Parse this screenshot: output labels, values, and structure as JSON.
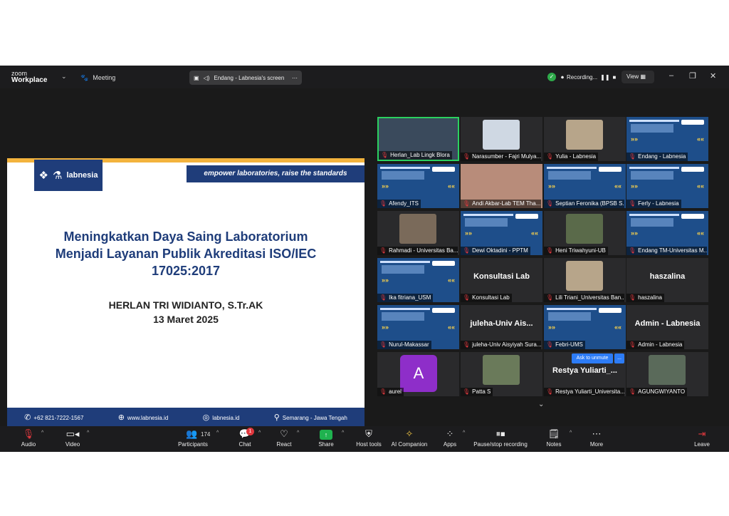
{
  "topbar": {
    "brand_small": "zoom",
    "brand_big": "Workplace",
    "meeting_label": "Meeting",
    "share_label": "Endang - Labnesia's screen",
    "recording_label": "Recording...",
    "view_label": "View"
  },
  "slide": {
    "logo_org": "labnesia",
    "tagline": "empower laboratories, raise the standards",
    "title_line1": "Meningkatkan Daya Saing Laboratorium",
    "title_line2": "Menjadi Layanan Publik Akreditasi ISO/IEC",
    "title_line3": "17025:2017",
    "presenter": "HERLAN TRI WIDIANTO, S.Tr.AK",
    "date": "13 Maret 2025",
    "footer": {
      "phone": "+62 821-7222-1567",
      "web": "www.labnesia.id",
      "instagram": "labnesia.id",
      "location": "Semarang - Jawa Tengah"
    }
  },
  "participants": [
    {
      "name": "Herlan_Lab Lingk Blora",
      "bigname": ""
    },
    {
      "name": "Narasumber - Fajri Mulya...",
      "bigname": ""
    },
    {
      "name": "Yulia - Labnesia",
      "bigname": ""
    },
    {
      "name": "Endang - Labnesia",
      "bigname": ""
    },
    {
      "name": "Afendy_ITS",
      "bigname": ""
    },
    {
      "name": "Andi Akbar-Lab TEM Tha...",
      "bigname": ""
    },
    {
      "name": "Septian Feronika (BPSB S...",
      "bigname": ""
    },
    {
      "name": "Ferly - Labnesia",
      "bigname": ""
    },
    {
      "name": "Rahmadi - Universitas Ba...",
      "bigname": ""
    },
    {
      "name": "Dewi Oktadini - PPTM",
      "bigname": ""
    },
    {
      "name": "Heni Triwahyuni-UB",
      "bigname": ""
    },
    {
      "name": "Endang TM-Universitas M...",
      "bigname": ""
    },
    {
      "name": "Ika fitriana_USM",
      "bigname": ""
    },
    {
      "name": "Konsultasi Lab",
      "bigname": "Konsultasi Lab"
    },
    {
      "name": "Lili Triani_Universitas Ban...",
      "bigname": ""
    },
    {
      "name": "haszalina",
      "bigname": "haszalina"
    },
    {
      "name": "Nurul-Makassar",
      "bigname": ""
    },
    {
      "name": "juleha-Univ Aisyiyah Sura...",
      "bigname": "juleha-Univ  Ais..."
    },
    {
      "name": "Febri-UMS",
      "bigname": ""
    },
    {
      "name": "Admin - Labnesia",
      "bigname": "Admin - Labnesia"
    },
    {
      "name": "aurel",
      "bigname": "",
      "initial": "A"
    },
    {
      "name": "Patta S",
      "bigname": ""
    },
    {
      "name": "Restya Yuliarti_Universita...",
      "bigname": "Restya  Yuliarti_..."
    },
    {
      "name": "AGUNGWIYANTO",
      "bigname": ""
    }
  ],
  "unmute": {
    "label": "Ask to unmute",
    "more": "..."
  },
  "toolbar": {
    "audio": "Audio",
    "video": "Video",
    "participants": "Participants",
    "participant_count": "174",
    "chat": "Chat",
    "chat_badge": "1",
    "react": "React",
    "share": "Share",
    "host_tools": "Host tools",
    "ai_companion": "AI Companion",
    "apps": "Apps",
    "pause_recording": "Pause/stop recording",
    "notes": "Notes",
    "more": "More",
    "leave": "Leave"
  },
  "colors": {
    "brand_blue": "#1f3d7a",
    "accent_orange": "#f3b33d",
    "active_speaker": "#2bd160",
    "muted_red": "#e0383e",
    "share_green": "#1fb24f"
  },
  "icons": [
    "dropdown-chevron-icon",
    "paw-icon",
    "screen-share-icon",
    "shield-icon",
    "record-icon",
    "mic-muted-icon",
    "camera-icon",
    "people-icon",
    "chat-icon",
    "heart-icon",
    "share-up-icon",
    "shield-host-icon",
    "sparkle-icon",
    "apps-icon",
    "pause-icon",
    "notes-icon",
    "more-icon",
    "leave-icon"
  ]
}
